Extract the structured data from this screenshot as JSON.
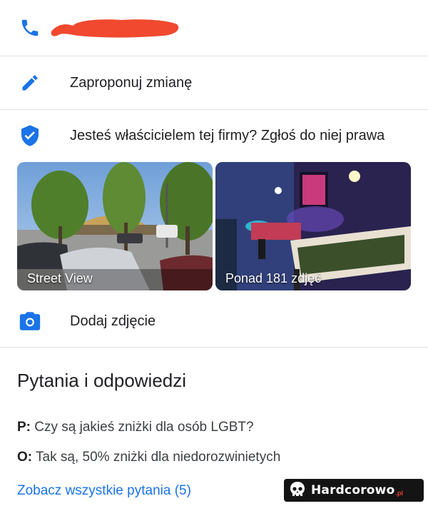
{
  "colors": {
    "accent_blue": "#1a73e8",
    "redaction_red": "#f0492f",
    "divider": "#e3e3e3"
  },
  "phone_row": {
    "icon": "phone-icon",
    "number_redacted": true
  },
  "edit_row": {
    "icon": "pencil-icon",
    "label": "Zaproponuj zmianę"
  },
  "owner_row": {
    "icon": "verified-shield-icon",
    "label": "Jesteś właścicielem tej firmy? Zgłoś do niej prawa"
  },
  "photos": [
    {
      "caption": "Street View"
    },
    {
      "caption": "Ponad 181 zdjęć"
    }
  ],
  "add_photo_row": {
    "icon": "camera-icon",
    "label": "Dodaj zdjęcie"
  },
  "qa": {
    "title": "Pytania i odpowiedzi",
    "question_prefix": "P:",
    "question": " Czy są jakieś zniżki dla osób LGBT?",
    "answer_prefix": "O:",
    "answer": " Tak są, 50% zniżki dla niedorozwinietych",
    "see_all_link": "Zobacz wszystkie pytania (5)"
  },
  "watermark": {
    "text": "Hardcorowo",
    "tld": ".pl"
  }
}
